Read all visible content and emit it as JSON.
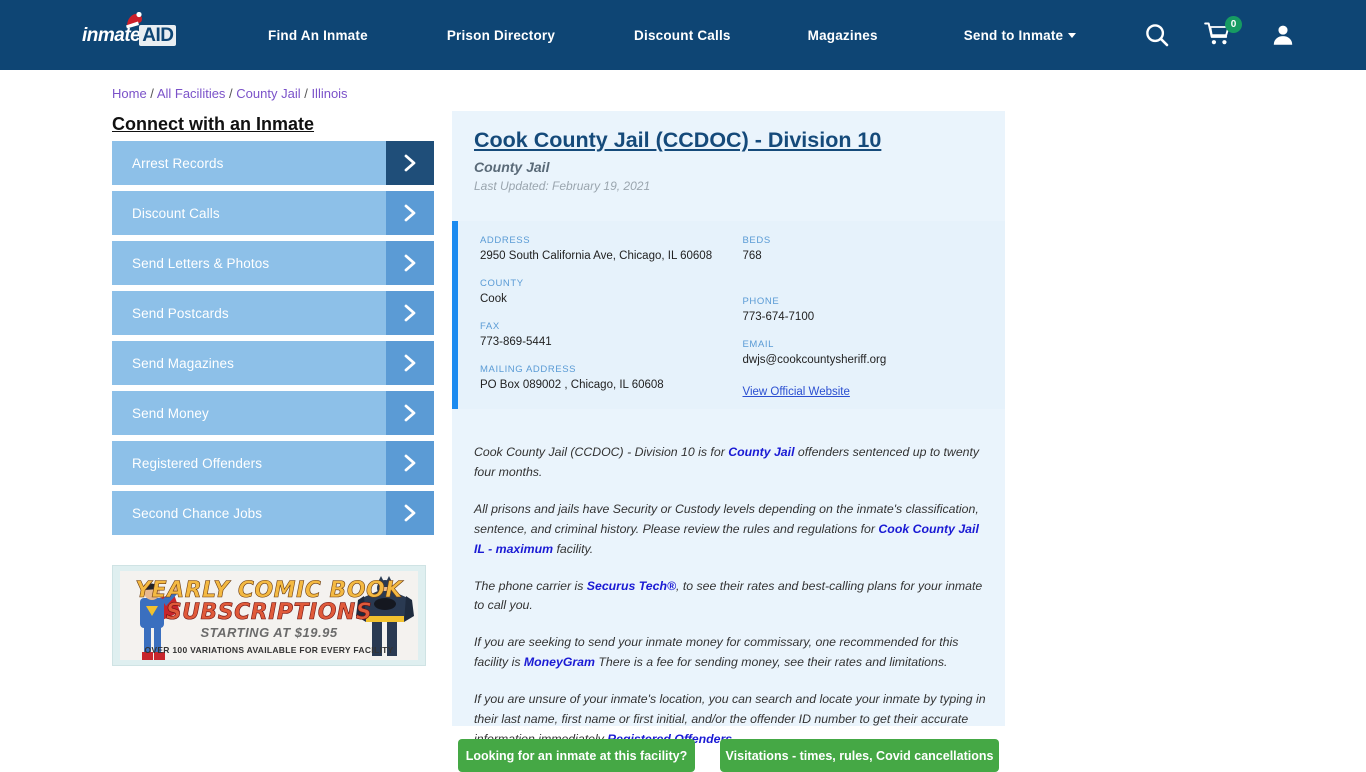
{
  "header": {
    "logo": {
      "brand": "inmate",
      "brand_suffix": "AID",
      "icon": "santa-hat-icon"
    },
    "nav": [
      {
        "label": "Find An Inmate"
      },
      {
        "label": "Prison Directory"
      },
      {
        "label": "Discount Calls"
      },
      {
        "label": "Magazines"
      },
      {
        "label": "Send to Inmate",
        "has_dropdown": true
      }
    ],
    "icons": {
      "search": "search-icon",
      "cart": "cart-icon",
      "cart_count": "0",
      "account": "user-account-icon"
    },
    "colors": {
      "bar": "#0e4574",
      "badge": "#169b62"
    }
  },
  "breadcrumb": {
    "items": [
      "Home",
      "All Facilities",
      "County Jail",
      "Illinois"
    ],
    "separator": "/"
  },
  "sidebar": {
    "title": "Connect with an Inmate",
    "items": [
      {
        "label": "Arrest Records",
        "active": true
      },
      {
        "label": "Discount Calls",
        "active": false
      },
      {
        "label": "Send Letters & Photos",
        "active": false
      },
      {
        "label": "Send Postcards",
        "active": false
      },
      {
        "label": "Send Magazines",
        "active": false
      },
      {
        "label": "Send Money",
        "active": false
      },
      {
        "label": "Registered Offenders",
        "active": false
      },
      {
        "label": "Second Chance Jobs",
        "active": false
      }
    ]
  },
  "ad": {
    "line1": "YEARLY COMIC BOOK",
    "line2": "SUBSCRIPTIONS",
    "line3": "STARTING AT $19.95",
    "line4": "OVER 100 VARIATIONS AVAILABLE FOR EVERY FACILITY",
    "left_character": "superman-figure",
    "right_character": "batman-figure"
  },
  "facility": {
    "title": "Cook County Jail (CCDOC) - Division 10",
    "type": "County Jail",
    "last_updated": "Last Updated: February 19, 2021",
    "info": {
      "address_label": "ADDRESS",
      "address_value": "2950 South California Ave, Chicago, IL 60608",
      "county_label": "COUNTY",
      "county_value": "Cook",
      "fax_label": "FAX",
      "fax_value": "773-869-5441",
      "mailing_label": "MAILING ADDRESS",
      "mailing_value": "PO Box 089002 , Chicago, IL 60608",
      "beds_label": "BEDS",
      "beds_value": "768",
      "phone_label": "PHONE",
      "phone_value": "773-674-7100",
      "email_label": "EMAIL",
      "email_value": "dwjs@cookcountysheriff.org",
      "website_link": "View Official Website"
    },
    "paragraphs": {
      "p1_a": "Cook County Jail (CCDOC) - Division 10 is for ",
      "p1_link": "County Jail",
      "p1_b": " offenders sentenced up to twenty four months.",
      "p2_a": "All prisons and jails have Security or Custody levels depending on the inmate's classification, sentence, and criminal history. Please review the rules and regulations for ",
      "p2_link": "Cook County Jail IL - maximum",
      "p2_b": " facility.",
      "p3_a": "The phone carrier is ",
      "p3_link": "Securus Tech®",
      "p3_b": ", to see their rates and best-calling plans for your inmate to call you.",
      "p4_a": "If you are seeking to send your inmate money for commissary, one recommended for this facility is ",
      "p4_link": "MoneyGram",
      "p4_b": " There is a fee for sending money, see their rates and limitations.",
      "p5_a": "If you are unsure of your inmate's location, you can search and locate your inmate by typing in their last name, first name or first initial, and/or the offender ID number to get their accurate information immediately ",
      "p5_link": "Registered Offenders",
      "p5_b": ""
    },
    "buttons": {
      "inmate_search": "Looking for an inmate at this facility?",
      "visitations": "Visitations - times, rules, Covid cancellations"
    }
  },
  "colors": {
    "header_bar": "#0e4574",
    "accent_blue": "#1b8bf0",
    "card_bg": "#eaf4fc",
    "sidebar_btn": "#8dc0e8",
    "sidebar_arrow": "#5b9bd5",
    "sidebar_arrow_active": "#1f4e79",
    "green_button": "#45a845",
    "link_blue": "#1a1ad4",
    "breadcrumb_link": "#7b52c9"
  }
}
